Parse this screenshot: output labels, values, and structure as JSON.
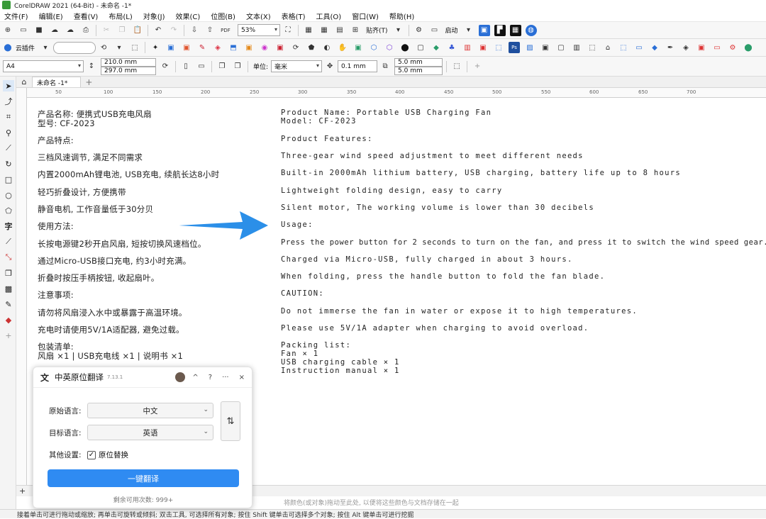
{
  "window_title": "CorelDRAW 2021 (64-Bit) - 未命名 -1*",
  "menu": [
    "文件(F)",
    "编辑(E)",
    "查看(V)",
    "布局(L)",
    "对象(J)",
    "效果(C)",
    "位图(B)",
    "文本(X)",
    "表格(T)",
    "工具(O)",
    "窗口(W)",
    "帮助(H)"
  ],
  "toolbar": {
    "pdf_label": "PDF",
    "zoom": "53%",
    "snap_label": "贴齐(T)",
    "launch_label": "启动",
    "cloud_plugin_label": "云插件"
  },
  "property_bar": {
    "page_size": "A4",
    "width": "210.0 mm",
    "height": "297.0 mm",
    "unit_label": "单位:",
    "unit_value": "毫米",
    "nudge": "0.1 mm",
    "dup_x": "5.0 mm",
    "dup_y": "5.0 mm"
  },
  "doc_tab": "未命名 -1*",
  "ruler_ticks": [
    "50",
    "100",
    "150",
    "200",
    "250",
    "300",
    "350",
    "400",
    "450",
    "500",
    "550",
    "600",
    "650",
    "700"
  ],
  "canvas": {
    "chinese": [
      "产品名称: 便携式USB充电风扇",
      "型号: CF-2023",
      "产品特点:",
      "三档风速调节, 满足不同需求",
      "内置2000mAh锂电池, USB充电, 续航长达8小时",
      "轻巧折叠设计, 方便携带",
      "静音电机, 工作音量低于30分贝",
      "使用方法:",
      "长按电源键2秒开启风扇, 短按切换风速档位。",
      "通过Micro-USB接口充电, 约3小时充满。",
      "折叠时按压手柄按钮, 收起扇叶。",
      "注意事项:",
      "请勿将风扇浸入水中或暴露于高温环境。",
      "充电时请使用5V/1A适配器, 避免过载。",
      "包装清单:",
      "风扇 ×1 | USB充电线 ×1 | 说明书 ×1"
    ],
    "english": [
      "Product Name: Portable USB Charging Fan",
      "Model: CF-2023",
      "Product Features:",
      "Three-gear wind speed adjustment to meet different needs",
      "Built-in 2000mAh lithium battery, USB charging, battery life up to 8 hours",
      "Lightweight folding design, easy to carry",
      "Silent motor, The working volume is lower than 30 decibels",
      "Usage:",
      "Press the power button for 2 seconds to turn on the fan, and press it to switch the wind speed gear.",
      "Charged via Micro-USB, fully charged in about 3 hours.",
      "When folding, press the handle button to fold the fan blade.",
      "CAUTION:",
      "Do not immerse the fan in water or expose it to high temperatures.",
      "Please use 5V/1A adapter when charging to avoid overload.",
      "Packing list:",
      "Fan × 1",
      "USB charging cable × 1",
      "Instruction manual × 1"
    ],
    "arrow_color": "#2b8fe8"
  },
  "dialog": {
    "title": "中英原位翻译",
    "version": "7.13.1",
    "header_buttons": [
      "^",
      "?",
      "···",
      "×"
    ],
    "source_label": "原始语言:",
    "source_value": "中文",
    "target_label": "目标语言:",
    "target_value": "英语",
    "other_label": "其他设置:",
    "replace_label": "原位替换",
    "translate_button": "一键翻译",
    "remaining": "剩余可用次数: 999+",
    "accent": "#2f8bf2"
  },
  "palette_hint": "将颜色(或对象)拖动至此处, 以便将这些颜色与文档存储在一起",
  "status_text": "接着单击可进行拖动或缩放; 再单击可旋转或倾斜; 双击工具, 可选择所有对象; 按住 Shift 键单击可选择多个对象; 按住 Alt 键单击可进行挖掘"
}
